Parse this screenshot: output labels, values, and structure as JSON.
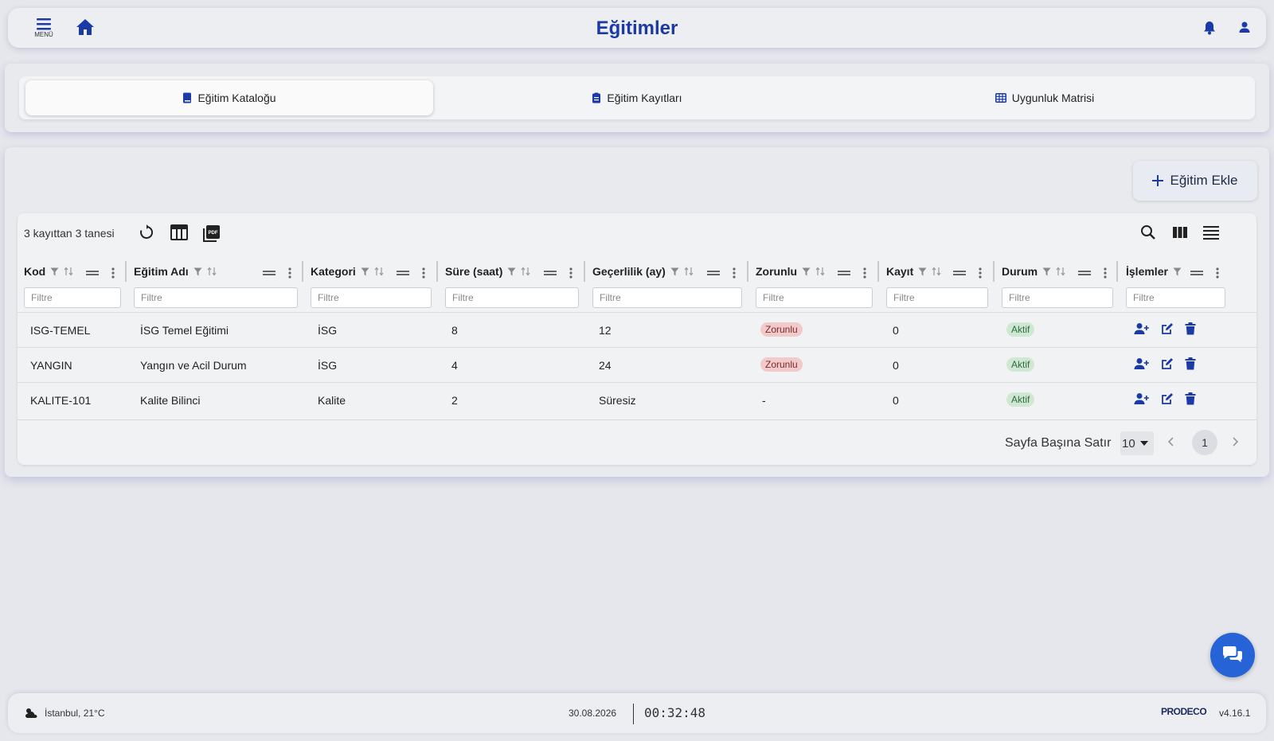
{
  "header": {
    "title": "Eğitimler",
    "menu_label": "MENÜ"
  },
  "tabs": [
    {
      "label": "Eğitim Kataloğu",
      "active": true
    },
    {
      "label": "Eğitim Kayıtları",
      "active": false
    },
    {
      "label": "Uygunluk Matrisi",
      "active": false
    }
  ],
  "add_button": {
    "label": "Eğitim Ekle"
  },
  "table": {
    "record_count": "3 kayıttan 3 tanesi",
    "filter_placeholder": "Filtre",
    "columns": [
      "Kod",
      "Eğitim Adı",
      "Kategori",
      "Süre (saat)",
      "Geçerlilik (ay)",
      "Zorunlu",
      "Kayıt",
      "Durum",
      "İşlemler"
    ],
    "rows": [
      {
        "kod": "ISG-TEMEL",
        "ad": "İSG Temel Eğitimi",
        "kategori": "İSG",
        "sure": "8",
        "gecerlilik": "12",
        "zorunlu": "Zorunlu",
        "kayit": "0",
        "durum": "Aktif"
      },
      {
        "kod": "YANGIN",
        "ad": "Yangın ve Acil Durum",
        "kategori": "İSG",
        "sure": "4",
        "gecerlilik": "24",
        "zorunlu": "Zorunlu",
        "kayit": "0",
        "durum": "Aktif"
      },
      {
        "kod": "KALITE-101",
        "ad": "Kalite Bilinci",
        "kategori": "Kalite",
        "sure": "2",
        "gecerlilik": "Süresiz",
        "zorunlu": "-",
        "kayit": "0",
        "durum": "Aktif"
      }
    ],
    "rows_per_page_label": "Sayfa Başına Satır",
    "rows_per_page_value": "10",
    "current_page": "1"
  },
  "footer": {
    "weather": "İstanbul, 21°C",
    "date": "30.08.2026",
    "time": "00:32:48",
    "brand": "PRODECO",
    "version": "v4.16.1"
  },
  "colors": {
    "primary": "#1c3aa6",
    "badge_required_bg": "#f3caca",
    "badge_active_bg": "#cfe8d4",
    "chat_fab": "#2563d6"
  }
}
